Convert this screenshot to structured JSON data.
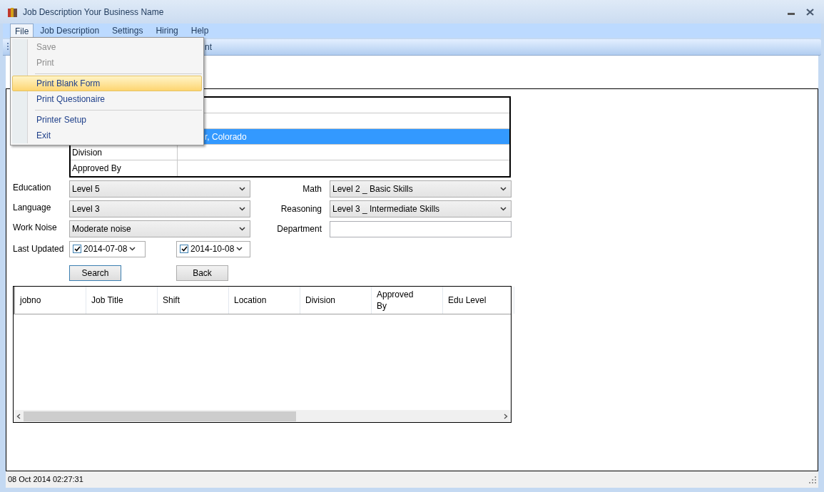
{
  "window": {
    "title": "Job Description Your Business Name"
  },
  "menubar": [
    {
      "label": "File",
      "selected": true
    },
    {
      "label": "Job Description",
      "selected": false
    },
    {
      "label": "Settings",
      "selected": false
    },
    {
      "label": "Hiring",
      "selected": false
    },
    {
      "label": "Help",
      "selected": false
    }
  ],
  "file_menu": [
    {
      "kind": "item",
      "label": "Save",
      "disabled": true,
      "selected": false
    },
    {
      "kind": "item",
      "label": "Print",
      "disabled": true,
      "selected": false
    },
    {
      "kind": "separator"
    },
    {
      "kind": "item",
      "label": "Print Blank Form",
      "disabled": false,
      "selected": true
    },
    {
      "kind": "item",
      "label": "Print Questionaire",
      "disabled": false,
      "selected": false
    },
    {
      "kind": "separator"
    },
    {
      "kind": "item",
      "label": "Printer Setup",
      "disabled": false,
      "selected": false
    },
    {
      "kind": "item",
      "label": "Exit",
      "disabled": false,
      "selected": false
    }
  ],
  "toolbar": {
    "text": "nt"
  },
  "details_grid": [
    {
      "selected": false
    },
    {
      "selected": false
    },
    {
      "value": "r, Colorado",
      "selected": true
    },
    {
      "label": "Division",
      "selected": false
    },
    {
      "label": "Approved By",
      "selected": false
    }
  ],
  "fields": [
    {
      "left": {
        "label": "Education",
        "value": "Level 5",
        "kind": "select"
      },
      "right": {
        "label": "Math",
        "value": "Level 2 _ Basic Skills",
        "kind": "select"
      }
    },
    {
      "left": {
        "label": "Language",
        "value": "Level 3",
        "kind": "select"
      },
      "right": {
        "label": "Reasoning",
        "value": "Level 3 _ Intermediate Skills",
        "kind": "select"
      }
    },
    {
      "left": {
        "label": "Work Noise",
        "value": "Moderate noise",
        "kind": "select"
      },
      "right": {
        "label": "Department",
        "kind": "text"
      }
    }
  ],
  "last_updated": {
    "label": "Last Updated",
    "dates": [
      {
        "value": "2014-07-08",
        "checked": true
      },
      {
        "value": "2014-10-08",
        "checked": true
      }
    ]
  },
  "buttons": [
    {
      "label": "Search",
      "focused": true
    },
    {
      "label": "Back",
      "focused": false
    }
  ],
  "table": {
    "columns": [
      "jobno",
      "Job Title",
      "Shift",
      "Location",
      "Division",
      "Approved By",
      "Edu Level"
    ]
  },
  "status_bar": {
    "text": "08 Oct 2014 02:27:31"
  }
}
